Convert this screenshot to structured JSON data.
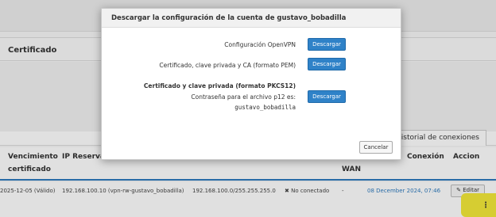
{
  "modal": {
    "title": "Descargar la configuración de la cuenta de gustavo_bobadilla",
    "rows": [
      {
        "label": "Configuración OpenVPN",
        "button": "Descargar"
      },
      {
        "label": "Certificado, clave privada y CA (formato PEM)",
        "button": "Descargar"
      },
      {
        "label": "Certificado y clave privada (formato PKCS12)",
        "sublabel": "Contraseña para el archivo p12 es:",
        "password": "gustavo_bobadilla",
        "button": "Descargar"
      }
    ],
    "cancel_label": "Cancelar"
  },
  "background": {
    "panel_title": "Certificado",
    "tab_label": "Historial de conexiones",
    "table_headers": {
      "col1_line1": "Vencimiento",
      "col1_line2": "certificado",
      "col2": "IP Reservada",
      "col3": "WAN",
      "col4": "Conexión",
      "col5": "Accion"
    },
    "row": {
      "expiry": "2025-12-05 (Válido)",
      "reserved_ip": "192.168.100.10 (vpn-rw-gustavo_bobadilla)",
      "network": "192.168.100.0/255.255.255.0",
      "status": "✖ No conectado",
      "wan": "-",
      "last_connection": "08 December 2024, 07:46",
      "edit_label": "✎ Editar"
    },
    "kebab": "⋮"
  },
  "colors": {
    "primary_button": "#2f82c8",
    "highlight": "#f4ea3a",
    "accent_line": "#2e7abe"
  }
}
